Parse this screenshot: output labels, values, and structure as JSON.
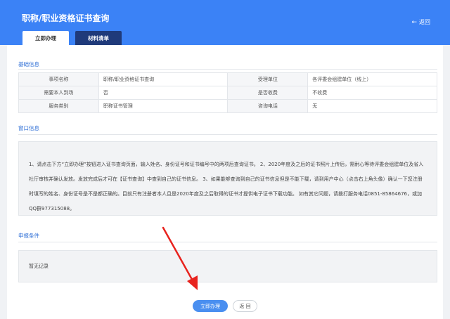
{
  "header": {
    "title": "职称/职业资格证书查询",
    "back_label": "返回",
    "tabs": [
      {
        "label": "立即办理"
      },
      {
        "label": "材料清单"
      }
    ]
  },
  "basic_info": {
    "section_title": "基础信息",
    "rows": [
      {
        "label1": "事项名称",
        "value1": "职称/职业资格证书查询",
        "label2": "受理单位",
        "value2": "各评委会组建单位（线上）"
      },
      {
        "label1": "需要本人到场",
        "value1": "否",
        "label2": "是否收费",
        "value2": "不收费"
      },
      {
        "label1": "服务类别",
        "value1": "职称证书管理",
        "label2": "咨询电话",
        "value2": "无"
      }
    ]
  },
  "window_info": {
    "section_title": "窗口信息",
    "notice": "1、请点击下方“立即办理”按钮进入证书查询页面，输入姓名、身份证号和证书编号中的两项后查询证书。 2、2020年度及之后的证书照片上传后，需耐心等待评委会组建单位及省人社厅审核并确认发放。发放完成后才可在【证书查询】中查到自己的证书信息。 3、如果能够查询到自己的证书信息但是不能下载，请到用户中心（点击右上角头像）确认一下您注册时填写的姓名、身份证号是不是都正确的。目前只有注册者本人且是2020年度及之后取得的证书才提供电子证书下载功能。 如有其它问题，请拨打服务电话0851-85864676，或加QQ群977315088。"
  },
  "conditions": {
    "section_title": "申报条件",
    "empty_text": "暂无记录"
  },
  "actions": {
    "primary_label": "立即办理",
    "back_label": "返 回"
  },
  "colors": {
    "header": "#3b82f6",
    "tab_inactive": "#1f3a7a",
    "primary": "#4a8ff0",
    "section_title": "#2f6fd6",
    "annotation_arrow": "#e8231e"
  }
}
